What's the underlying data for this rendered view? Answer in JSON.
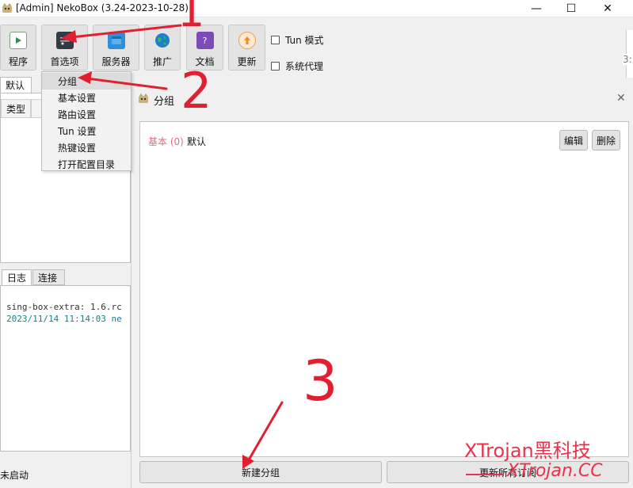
{
  "window": {
    "title": "[Admin] NekoBox (3.24-2023-10-28)",
    "controls": {
      "minimize": "—",
      "maximize": "☐",
      "close": "✕"
    }
  },
  "toolbar": {
    "buttons": [
      {
        "label": "程序",
        "icon": "program-icon",
        "color": "#2e8b57"
      },
      {
        "label": "首选项",
        "icon": "preferences-icon",
        "color": "#333a44"
      },
      {
        "label": "服务器",
        "icon": "server-icon",
        "color": "#2f8fd8"
      },
      {
        "label": "推广",
        "icon": "globe-icon",
        "color": "#1f7fc8"
      },
      {
        "label": "文档",
        "icon": "document-icon",
        "color": "#7b4bb7"
      },
      {
        "label": "更新",
        "icon": "update-icon",
        "color": "#f08a24"
      }
    ],
    "checkboxes": [
      {
        "label": "Tun 模式",
        "checked": false
      },
      {
        "label": "系统代理",
        "checked": false
      }
    ]
  },
  "left_pane": {
    "group_tab": "默认",
    "column_header": "类型",
    "log_tabs": [
      "日志",
      "连接"
    ],
    "log_lines": [
      {
        "text": "sing-box-extra: 1.6.rc",
        "color": "#333333"
      },
      {
        "text": "2023/11/14 11:14:03 ne",
        "color": "#1a7f8e"
      }
    ],
    "status": "未启动"
  },
  "menu": {
    "items": [
      "分组",
      "基本设置",
      "路由设置",
      "Tun 设置",
      "热键设置",
      "打开配置目录"
    ],
    "highlighted_index": 0
  },
  "dialog": {
    "title": "分组",
    "close_glyph": "✕",
    "group": {
      "type_label": "基本 (0)",
      "name": "默认",
      "type_color": "#e06b7d"
    },
    "edit_button": "编辑",
    "delete_button": "删除",
    "new_group_button": "新建分组",
    "update_subs_button": "更新所有订阅"
  },
  "annotations": {
    "numbers": [
      "1",
      "2",
      "3"
    ],
    "color": "#e02030"
  },
  "watermark": {
    "line1": "XTrojan黑科技",
    "line2": "XTrojan.CC"
  },
  "edge_fragment": "3:"
}
